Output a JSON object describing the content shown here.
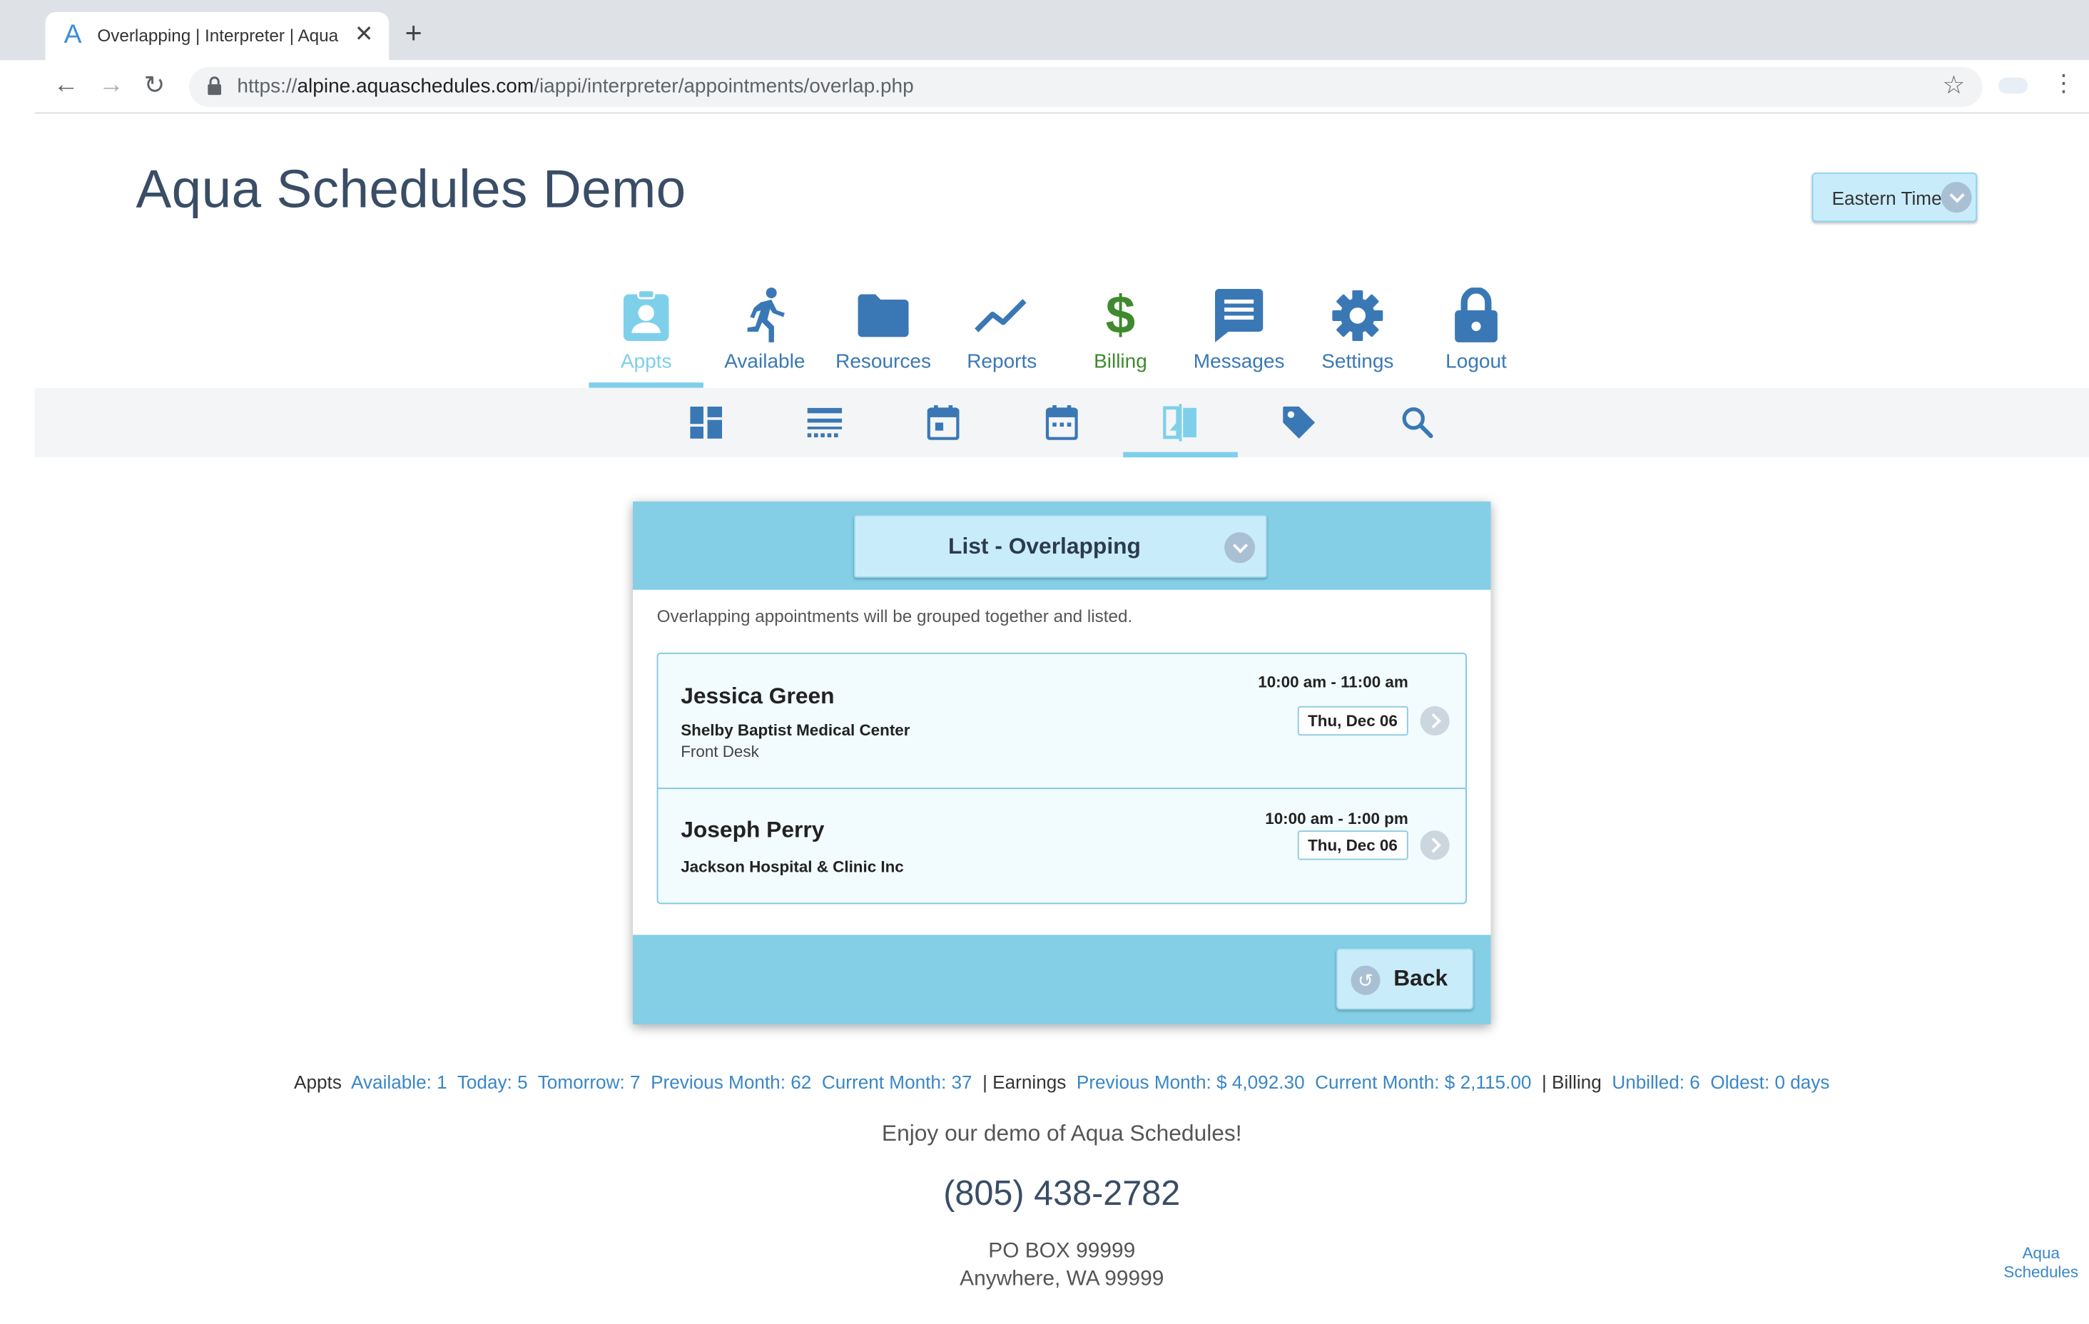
{
  "browser": {
    "tab_title": "Overlapping | Interpreter | Aqua Schedules",
    "tab_icon": "aqua-logo-icon",
    "url_prefix": "https://",
    "url_host": "alpine.aquaschedules.com",
    "url_path": "/iappi/interpreter/appointments/overlap.php"
  },
  "header": {
    "site_title": "Aqua Schedules Demo",
    "timezone_label": "Eastern Time"
  },
  "nav": {
    "items": [
      {
        "label": "Appts",
        "icon": "badge-icon",
        "color": "#7ed0ea",
        "active": true
      },
      {
        "label": "Available",
        "icon": "running-person-icon",
        "color": "#3a78b5"
      },
      {
        "label": "Resources",
        "icon": "folder-icon",
        "color": "#3a78b5"
      },
      {
        "label": "Reports",
        "icon": "trend-line-icon",
        "color": "#3a78b5"
      },
      {
        "label": "Billing",
        "icon": "dollar-icon",
        "color": "#3f8a2e"
      },
      {
        "label": "Messages",
        "icon": "message-icon",
        "color": "#3a78b5"
      },
      {
        "label": "Settings",
        "icon": "gear-icon",
        "color": "#3a78b5"
      },
      {
        "label": "Logout",
        "icon": "lock-icon",
        "color": "#3a78b5"
      }
    ]
  },
  "subnav": {
    "items": [
      {
        "icon": "dashboard-icon"
      },
      {
        "icon": "list-view-icon"
      },
      {
        "icon": "calendar-day-icon"
      },
      {
        "icon": "calendar-week-icon"
      },
      {
        "icon": "overlap-icon",
        "active": true
      },
      {
        "icon": "tag-icon"
      },
      {
        "icon": "search-icon"
      }
    ]
  },
  "panel": {
    "selector_label": "List - Overlapping",
    "note": "Overlapping appointments will be grouped together and listed.",
    "appointments": [
      {
        "name": "Jessica Green",
        "facility": "Shelby Baptist Medical Center",
        "department": "Front Desk",
        "time": "10:00 am - 11:00 am",
        "date": "Thu, Dec 06"
      },
      {
        "name": "Joseph Perry",
        "facility": "Jackson Hospital & Clinic Inc",
        "department": "",
        "time": "10:00 am - 1:00 pm",
        "date": "Thu, Dec 06"
      }
    ],
    "back_label": "Back"
  },
  "footer": {
    "appts_label": "Appts",
    "available": "Available: 1",
    "today": "Today: 5",
    "tomorrow": "Tomorrow: 7",
    "prev_month": "Previous Month: 62",
    "cur_month": "Current Month: 37",
    "earnings_label": "| Earnings",
    "earn_prev": "Previous Month: $ 4,092.30",
    "earn_cur": "Current Month: $ 2,115.00",
    "billing_label": "| Billing",
    "unbilled": "Unbilled: 6",
    "oldest": "Oldest: 0 days",
    "enjoy": "Enjoy our demo of Aqua Schedules!",
    "phone": "(805) 438-2782",
    "address1": "PO BOX 99999",
    "address2": "Anywhere, WA 99999",
    "logo_line1": "Aqua",
    "logo_line2": "Schedules"
  }
}
